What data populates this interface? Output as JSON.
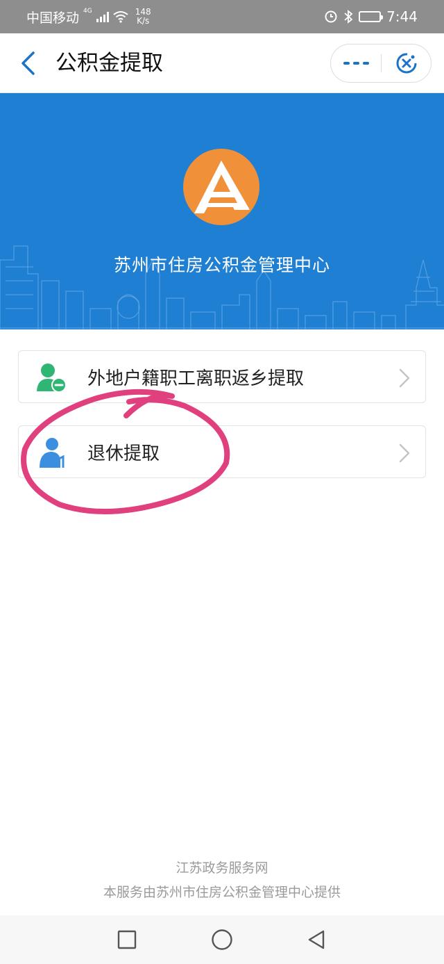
{
  "status_bar": {
    "carrier": "中国移动",
    "network": "4G",
    "speed_value": "148",
    "speed_unit": "K/s",
    "time": "7:44"
  },
  "nav": {
    "title": "公积金提取",
    "icons": {
      "back": "chevron-left-icon",
      "more": "more-icon",
      "close": "close-miniapp-icon"
    },
    "accent_color": "#1a73c8"
  },
  "banner": {
    "org_name": "苏州市住房公积金管理中心",
    "background_color": "#1f7fd3",
    "logo_color": "#f0913a"
  },
  "menu": {
    "items": [
      {
        "label": "外地户籍职工离职返乡提取",
        "icon": "user-minus-icon",
        "icon_color": "#2fb574"
      },
      {
        "label": "退休提取",
        "icon": "elderly-person-icon",
        "icon_color": "#3c8fe0"
      }
    ]
  },
  "annotation": {
    "color": "#e0407d"
  },
  "footer": {
    "line1": "江苏政务服务网",
    "line2": "本服务由苏州市住房公积金管理中心提供"
  },
  "system_nav": {
    "icons": [
      "recent-apps-icon",
      "home-icon",
      "back-icon"
    ]
  }
}
